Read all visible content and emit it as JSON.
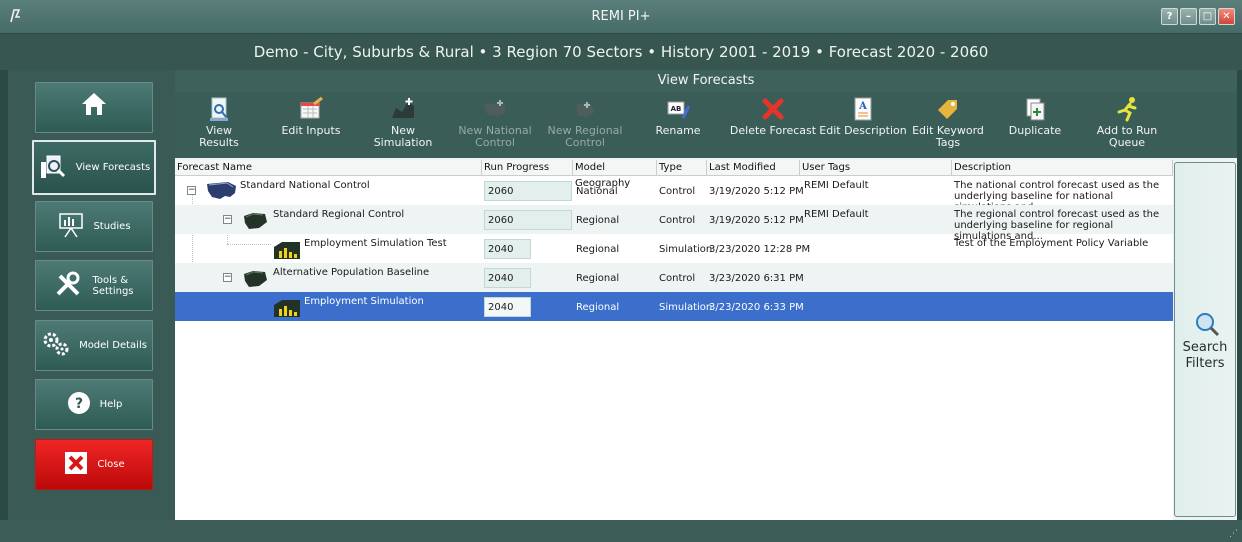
{
  "window": {
    "title": "REMI PI+"
  },
  "subtitle": "Demo - City, Suburbs & Rural • 3 Region 70 Sectors • History 2001 - 2019 • Forecast 2020 - 2060",
  "nav": [
    {
      "label": "",
      "icon": "home-icon"
    },
    {
      "label": "View Forecasts",
      "icon": "view-forecasts-icon"
    },
    {
      "label": "Studies",
      "icon": "studies-icon"
    },
    {
      "label": "Tools &\nSettings",
      "icon": "tools-icon"
    },
    {
      "label": "Model Details",
      "icon": "gears-icon"
    },
    {
      "label": "Help",
      "icon": "help-icon"
    },
    {
      "label": "Close",
      "icon": "close-icon"
    }
  ],
  "panel_title": "View Forecasts",
  "toolbar": [
    {
      "label": "View Results",
      "enabled": true
    },
    {
      "label": "Edit Inputs",
      "enabled": true
    },
    {
      "label": "New Simulation",
      "enabled": true
    },
    {
      "label": "New National\nControl",
      "enabled": false
    },
    {
      "label": "New Regional\nControl",
      "enabled": false
    },
    {
      "label": "Rename",
      "enabled": true
    },
    {
      "label": "Delete Forecast",
      "enabled": true
    },
    {
      "label": "Edit Description",
      "enabled": true
    },
    {
      "label": "Edit Keyword\nTags",
      "enabled": true
    },
    {
      "label": "Duplicate",
      "enabled": true
    },
    {
      "label": "Add to Run\nQueue",
      "enabled": true
    }
  ],
  "columns": [
    "Forecast Name",
    "Run Progress",
    "Model Geography",
    "Type",
    "Last Modified",
    "User Tags",
    "Description"
  ],
  "rows": [
    {
      "name": "Standard National Control",
      "progress": "2060",
      "geography": "National",
      "type": "Control",
      "modified": "3/19/2020 5:12 PM",
      "tags": "REMI Default",
      "description": "The national control forecast used as the underlying baseline for national simulations and..."
    },
    {
      "name": "Standard Regional Control",
      "progress": "2060",
      "geography": "Regional",
      "type": "Control",
      "modified": "3/19/2020 5:12 PM",
      "tags": "REMI Default",
      "description": "The regional control forecast used as the underlying baseline for regional simulations and..."
    },
    {
      "name": "Employment Simulation Test",
      "progress": "2040",
      "geography": "Regional",
      "type": "Simulation",
      "modified": "3/23/2020 12:28 PM",
      "tags": "",
      "description": "Test of the Employment Policy Variable"
    },
    {
      "name": "Alternative Population Baseline",
      "progress": "2040",
      "geography": "Regional",
      "type": "Control",
      "modified": "3/23/2020 6:31 PM",
      "tags": "",
      "description": ""
    },
    {
      "name": "Employment Simulation",
      "progress": "2040",
      "geography": "Regional",
      "type": "Simulation",
      "modified": "3/23/2020 6:33 PM",
      "tags": "",
      "description": ""
    }
  ],
  "search_filters": "Search\nFilters",
  "colors": {
    "accent": "#3b6fcb",
    "frame": "#3b5d57",
    "close": "#e01818"
  }
}
